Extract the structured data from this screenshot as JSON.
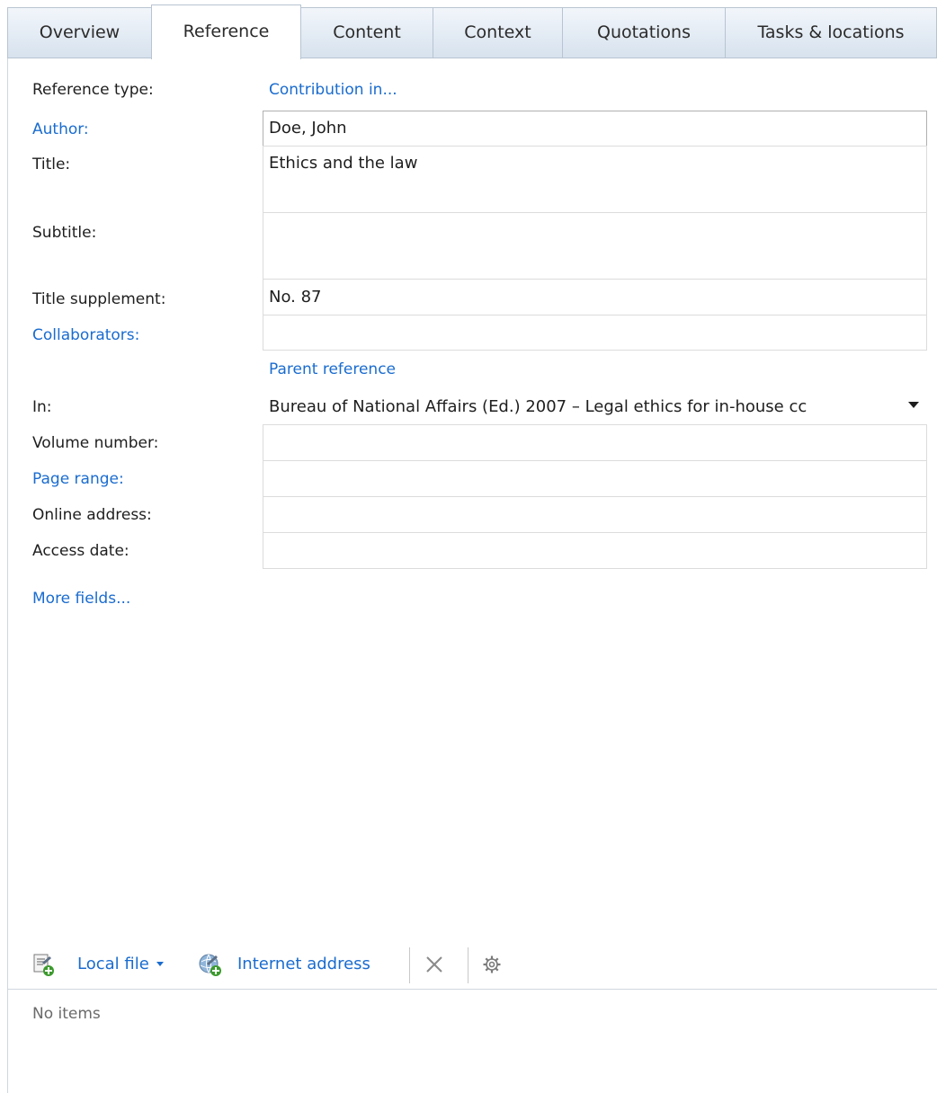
{
  "tabs": [
    {
      "label": "Overview"
    },
    {
      "label": "Reference"
    },
    {
      "label": "Content"
    },
    {
      "label": "Context"
    },
    {
      "label": "Quotations"
    },
    {
      "label": "Tasks & locations"
    }
  ],
  "active_tab": "Reference",
  "form": {
    "reference_type_label": "Reference type:",
    "reference_type_value": "Contribution in...",
    "author_label": "Author:",
    "author_value": "Doe, John",
    "title_label": "Title:",
    "title_value": "Ethics and the law",
    "subtitle_label": "Subtitle:",
    "subtitle_value": "",
    "title_supplement_label": "Title supplement:",
    "title_supplement_value": "No. 87",
    "collaborators_label": "Collaborators:",
    "collaborators_value": "",
    "parent_reference_heading": "Parent reference",
    "in_label": "In:",
    "in_value": "Bureau of National Affairs (Ed.) 2007 – Legal ethics for in-house cc",
    "volume_number_label": "Volume number:",
    "volume_number_value": "",
    "page_range_label": "Page range:",
    "page_range_value": "",
    "online_address_label": "Online address:",
    "online_address_value": "",
    "access_date_label": "Access date:",
    "access_date_value": "",
    "more_fields_link": "More fields..."
  },
  "attachments": {
    "local_file_label": "Local file",
    "internet_address_label": "Internet address",
    "empty_text": "No items"
  },
  "colors": {
    "link": "#1a6ccf",
    "tab_inactive_top": "#f2f6fb",
    "tab_inactive_bottom": "#d7e2ee",
    "border": "#b8c4d2"
  },
  "icons": {
    "local_file": "add-local-file-icon",
    "internet_address": "add-internet-address-icon",
    "delete": "delete-x-icon",
    "settings": "gear-icon",
    "combo": "dropdown-arrow-icon"
  }
}
